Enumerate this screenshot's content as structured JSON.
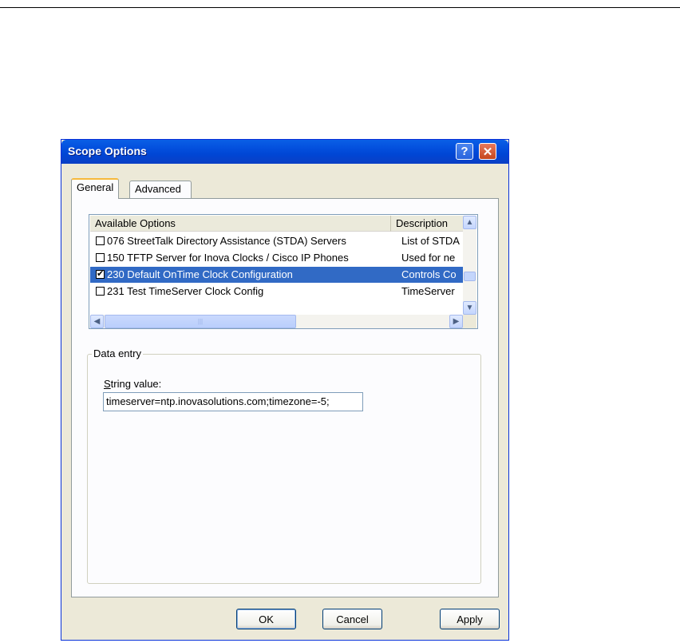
{
  "window": {
    "title": "Scope Options"
  },
  "tabs": [
    {
      "label": "General",
      "selected": true
    },
    {
      "label": "Advanced",
      "selected": false
    }
  ],
  "options_list": {
    "columns": [
      "Available Options",
      "Description"
    ],
    "rows": [
      {
        "checked": false,
        "option": "076 StreetTalk Directory Assistance (STDA) Servers",
        "description": "List of STDA",
        "selected": false
      },
      {
        "checked": false,
        "option": "150 TFTP Server for Inova Clocks / Cisco IP Phones",
        "description": "Used for ne",
        "selected": false
      },
      {
        "checked": true,
        "option": "230 Default OnTime Clock Configuration",
        "description": "Controls Co",
        "selected": true
      },
      {
        "checked": false,
        "option": "231 Test TimeServer Clock Config",
        "description": "TimeServer",
        "selected": false
      }
    ]
  },
  "data_entry": {
    "group_label": "Data entry",
    "field_label_accel": "S",
    "field_label_rest": "tring value:",
    "string_value": "timeserver=ntp.inovasolutions.com;timezone=-5;"
  },
  "buttons": {
    "ok": "OK",
    "cancel": "Cancel",
    "apply": "Apply"
  },
  "colors": {
    "titlebar": "#0054e3",
    "selection": "#316ac5",
    "dialog_bg": "#ece9d8"
  }
}
